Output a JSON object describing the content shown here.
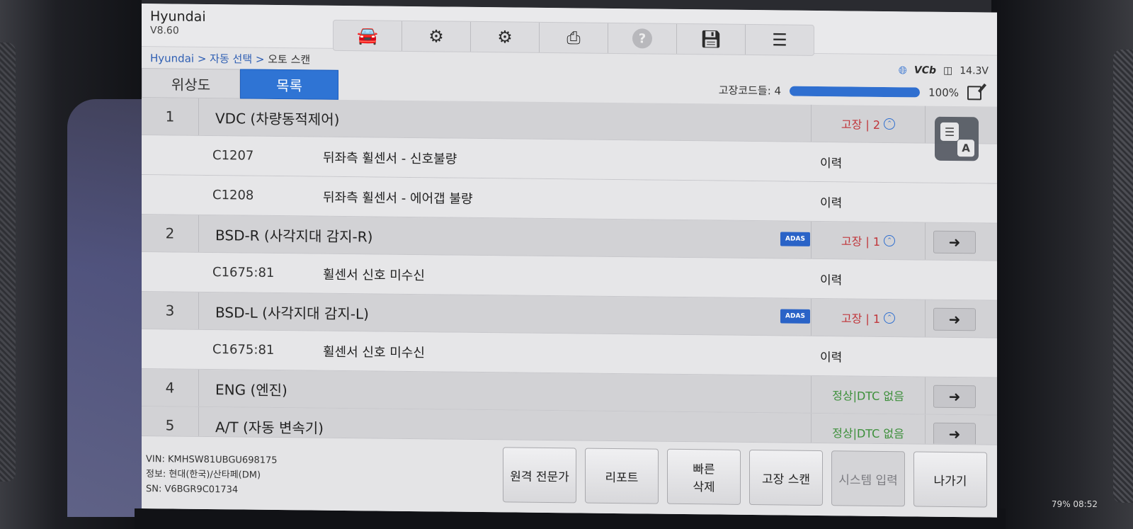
{
  "app": {
    "name": "Hyundai",
    "version": "V8.60"
  },
  "toolbar": [
    {
      "name": "car-cloud-icon"
    },
    {
      "name": "car-lift-icon"
    },
    {
      "name": "gear-icon"
    },
    {
      "name": "printer-icon"
    },
    {
      "name": "help-icon"
    },
    {
      "name": "save-icon"
    },
    {
      "name": "chat-icon"
    }
  ],
  "breadcrumb": {
    "part1": "Hyundai",
    "part2": "자동 선택",
    "current": "오토 스캔"
  },
  "status": {
    "vci": "VCb",
    "voltage": "14.3V"
  },
  "tabs": {
    "topology": "위상도",
    "list": "목록"
  },
  "faults": {
    "label": "고장코드들: 4",
    "progress_pct": 100,
    "progress_label": "100%"
  },
  "systems": [
    {
      "num": "1",
      "name": "VDC (차량동적제어)",
      "status": "고장 | 2",
      "status_type": "fault",
      "adas": false,
      "codes": [
        {
          "code": "C1207",
          "desc": "뒤좌측 휠센서 - 신호불량",
          "state": "이력"
        },
        {
          "code": "C1208",
          "desc": "뒤좌측 휠센서 - 에어갭 불량",
          "state": "이력"
        }
      ]
    },
    {
      "num": "2",
      "name": "BSD-R (사각지대 감지-R)",
      "status": "고장 | 1",
      "status_type": "fault",
      "adas": true,
      "codes": [
        {
          "code": "C1675:81",
          "desc": "휠센서 신호 미수신",
          "state": "이력"
        }
      ]
    },
    {
      "num": "3",
      "name": "BSD-L (사각지대 감지-L)",
      "status": "고장 | 1",
      "status_type": "fault",
      "adas": true,
      "codes": [
        {
          "code": "C1675:81",
          "desc": "휠센서 신호 미수신",
          "state": "이력"
        }
      ]
    },
    {
      "num": "4",
      "name": "ENG (엔진)",
      "status": "정상|DTC 없음",
      "status_type": "ok",
      "adas": false,
      "codes": []
    },
    {
      "num": "5",
      "name": "A/T (자동 변속기)",
      "status": "정상|DTC 없음",
      "status_type": "ok",
      "adas": false,
      "codes": []
    }
  ],
  "adas_label": "ADAS",
  "vehicle": {
    "vin": "VIN: KMHSW81UBGU698175",
    "info": "정보: 현대(한국)/산타페(DM)",
    "sn": "SN: V6BGR9C01734"
  },
  "footer_buttons": {
    "remote": "원격 전문가",
    "report": "리포트",
    "quick_clear": "빠른\n삭제",
    "fault_scan": "고장 스캔",
    "system_enter": "시스템 입력",
    "exit": "나가기"
  },
  "sysbar": "79% 08:52"
}
